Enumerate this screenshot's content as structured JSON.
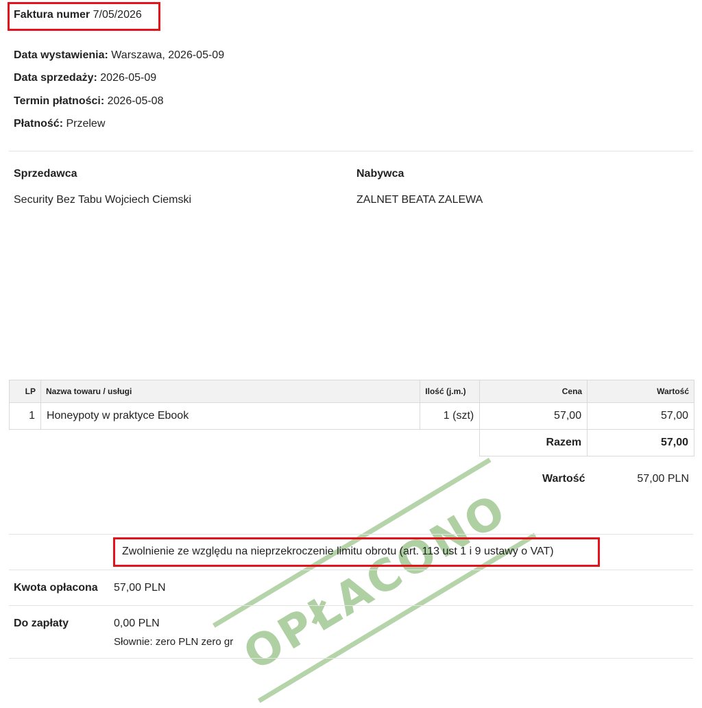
{
  "header": {
    "invoice_label": "Faktura numer",
    "invoice_number": "7/05/2026"
  },
  "meta": [
    {
      "label": "Data wystawienia:",
      "value": "Warszawa, 2026-05-09"
    },
    {
      "label": "Data sprzedaży:",
      "value": "2026-05-09"
    },
    {
      "label": "Termin płatności:",
      "value": "2026-05-08"
    },
    {
      "label": "Płatność:",
      "value": "Przelew"
    }
  ],
  "seller": {
    "heading": "Sprzedawca",
    "name": "Security Bez Tabu Wojciech Ciemski"
  },
  "buyer": {
    "heading": "Nabywca",
    "name": "ZALNET BEATA ZALEWA"
  },
  "table": {
    "headers": [
      "LP",
      "Nazwa towaru / usługi",
      "Ilość (j.m.)",
      "Cena",
      "Wartość"
    ],
    "rows": [
      [
        "1",
        "Honeypoty w praktyce Ebook",
        "1 (szt)",
        "57,00",
        "57,00"
      ]
    ],
    "total_label": "Razem",
    "total_value": "57,00"
  },
  "summary": {
    "label": "Wartość",
    "value": "57,00 PLN"
  },
  "vat_note": "Zwolnienie ze względu na nieprzekroczenie limitu obrotu (art. 113 ust 1 i 9 ustawy o VAT)",
  "paid": {
    "label": "Kwota opłacona",
    "value": "57,00 PLN"
  },
  "due": {
    "label": "Do zapłaty",
    "value": "0,00 PLN",
    "in_words": "Słownie: zero PLN zero gr"
  },
  "stamp": {
    "text": "OPŁACONO",
    "color": "#9cc58d"
  },
  "highlight_color": "#e3121b"
}
